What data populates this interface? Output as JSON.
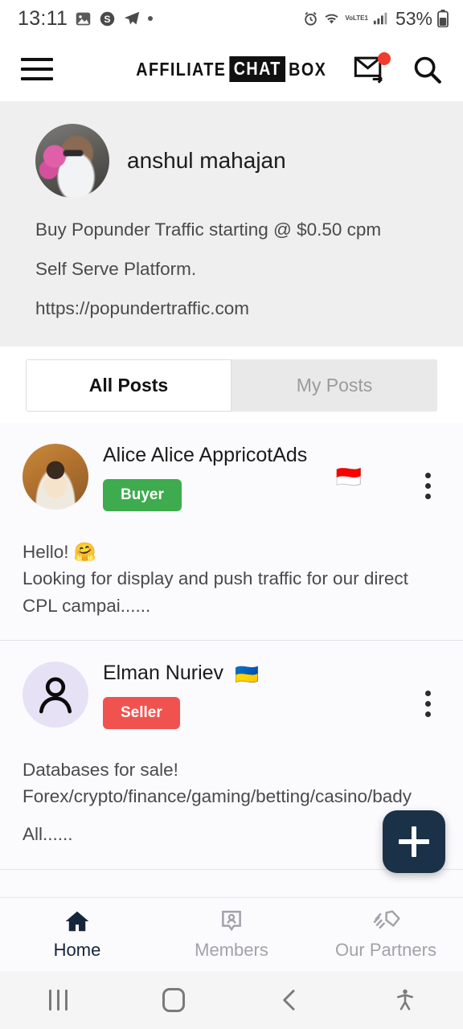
{
  "status_bar": {
    "time": "13:11",
    "battery_percent": "53%",
    "network_label": "VoLTE1",
    "icons": [
      "image-icon",
      "skype-icon",
      "telegram-icon",
      "dot-icon",
      "alarm-icon",
      "wifi-icon",
      "signal-icon",
      "battery-icon"
    ]
  },
  "header": {
    "logo_part1": "AFFILIATE",
    "logo_part2": "CHAT",
    "logo_part3": "BOX",
    "menu_icon": "hamburger-icon",
    "mail_icon": "mail-forward-icon",
    "search_icon": "search-icon",
    "badge_color": "#f03b2d"
  },
  "profile": {
    "name": "anshul mahajan",
    "bio_lines": [
      "Buy Popunder Traffic starting @ $0.50 cpm",
      "Self Serve Platform.",
      "https://popundertraffic.com"
    ]
  },
  "tabs": [
    {
      "label": "All Posts",
      "active": true
    },
    {
      "label": "My Posts",
      "active": false
    }
  ],
  "posts": [
    {
      "name": "Alice Alice AppricotAds",
      "flag": "🇮🇩",
      "flag_name": "indonesia-flag",
      "badge_label": "Buyer",
      "badge_color": "#3eab4e",
      "avatar_type": "photo",
      "body_line1": "Hello! 🤗",
      "body_line2": "Looking for display and push traffic for our direct CPL campai......"
    },
    {
      "name": "Elman Nuriev",
      "flag": "🇺🇦",
      "flag_name": "ukraine-flag",
      "badge_label": "Seller",
      "badge_color": "#f0534f",
      "avatar_type": "default",
      "body_line1": "Databases for sale!",
      "body_line2": "Forex/crypto/finance/gaming/betting/casino/bady",
      "body_line3": "All......"
    }
  ],
  "fab": {
    "label": "+",
    "icon": "plus-icon",
    "color": "#1b3148"
  },
  "bottom_nav": [
    {
      "label": "Home",
      "icon": "home-icon",
      "active": true
    },
    {
      "label": "Members",
      "icon": "contact-card-icon",
      "active": false
    },
    {
      "label": "Our Partners",
      "icon": "handshake-icon",
      "active": false
    }
  ],
  "system_nav": {
    "recents": "recents-icon",
    "home": "home-square-icon",
    "back": "back-chevron-icon",
    "accessibility": "accessibility-icon"
  }
}
